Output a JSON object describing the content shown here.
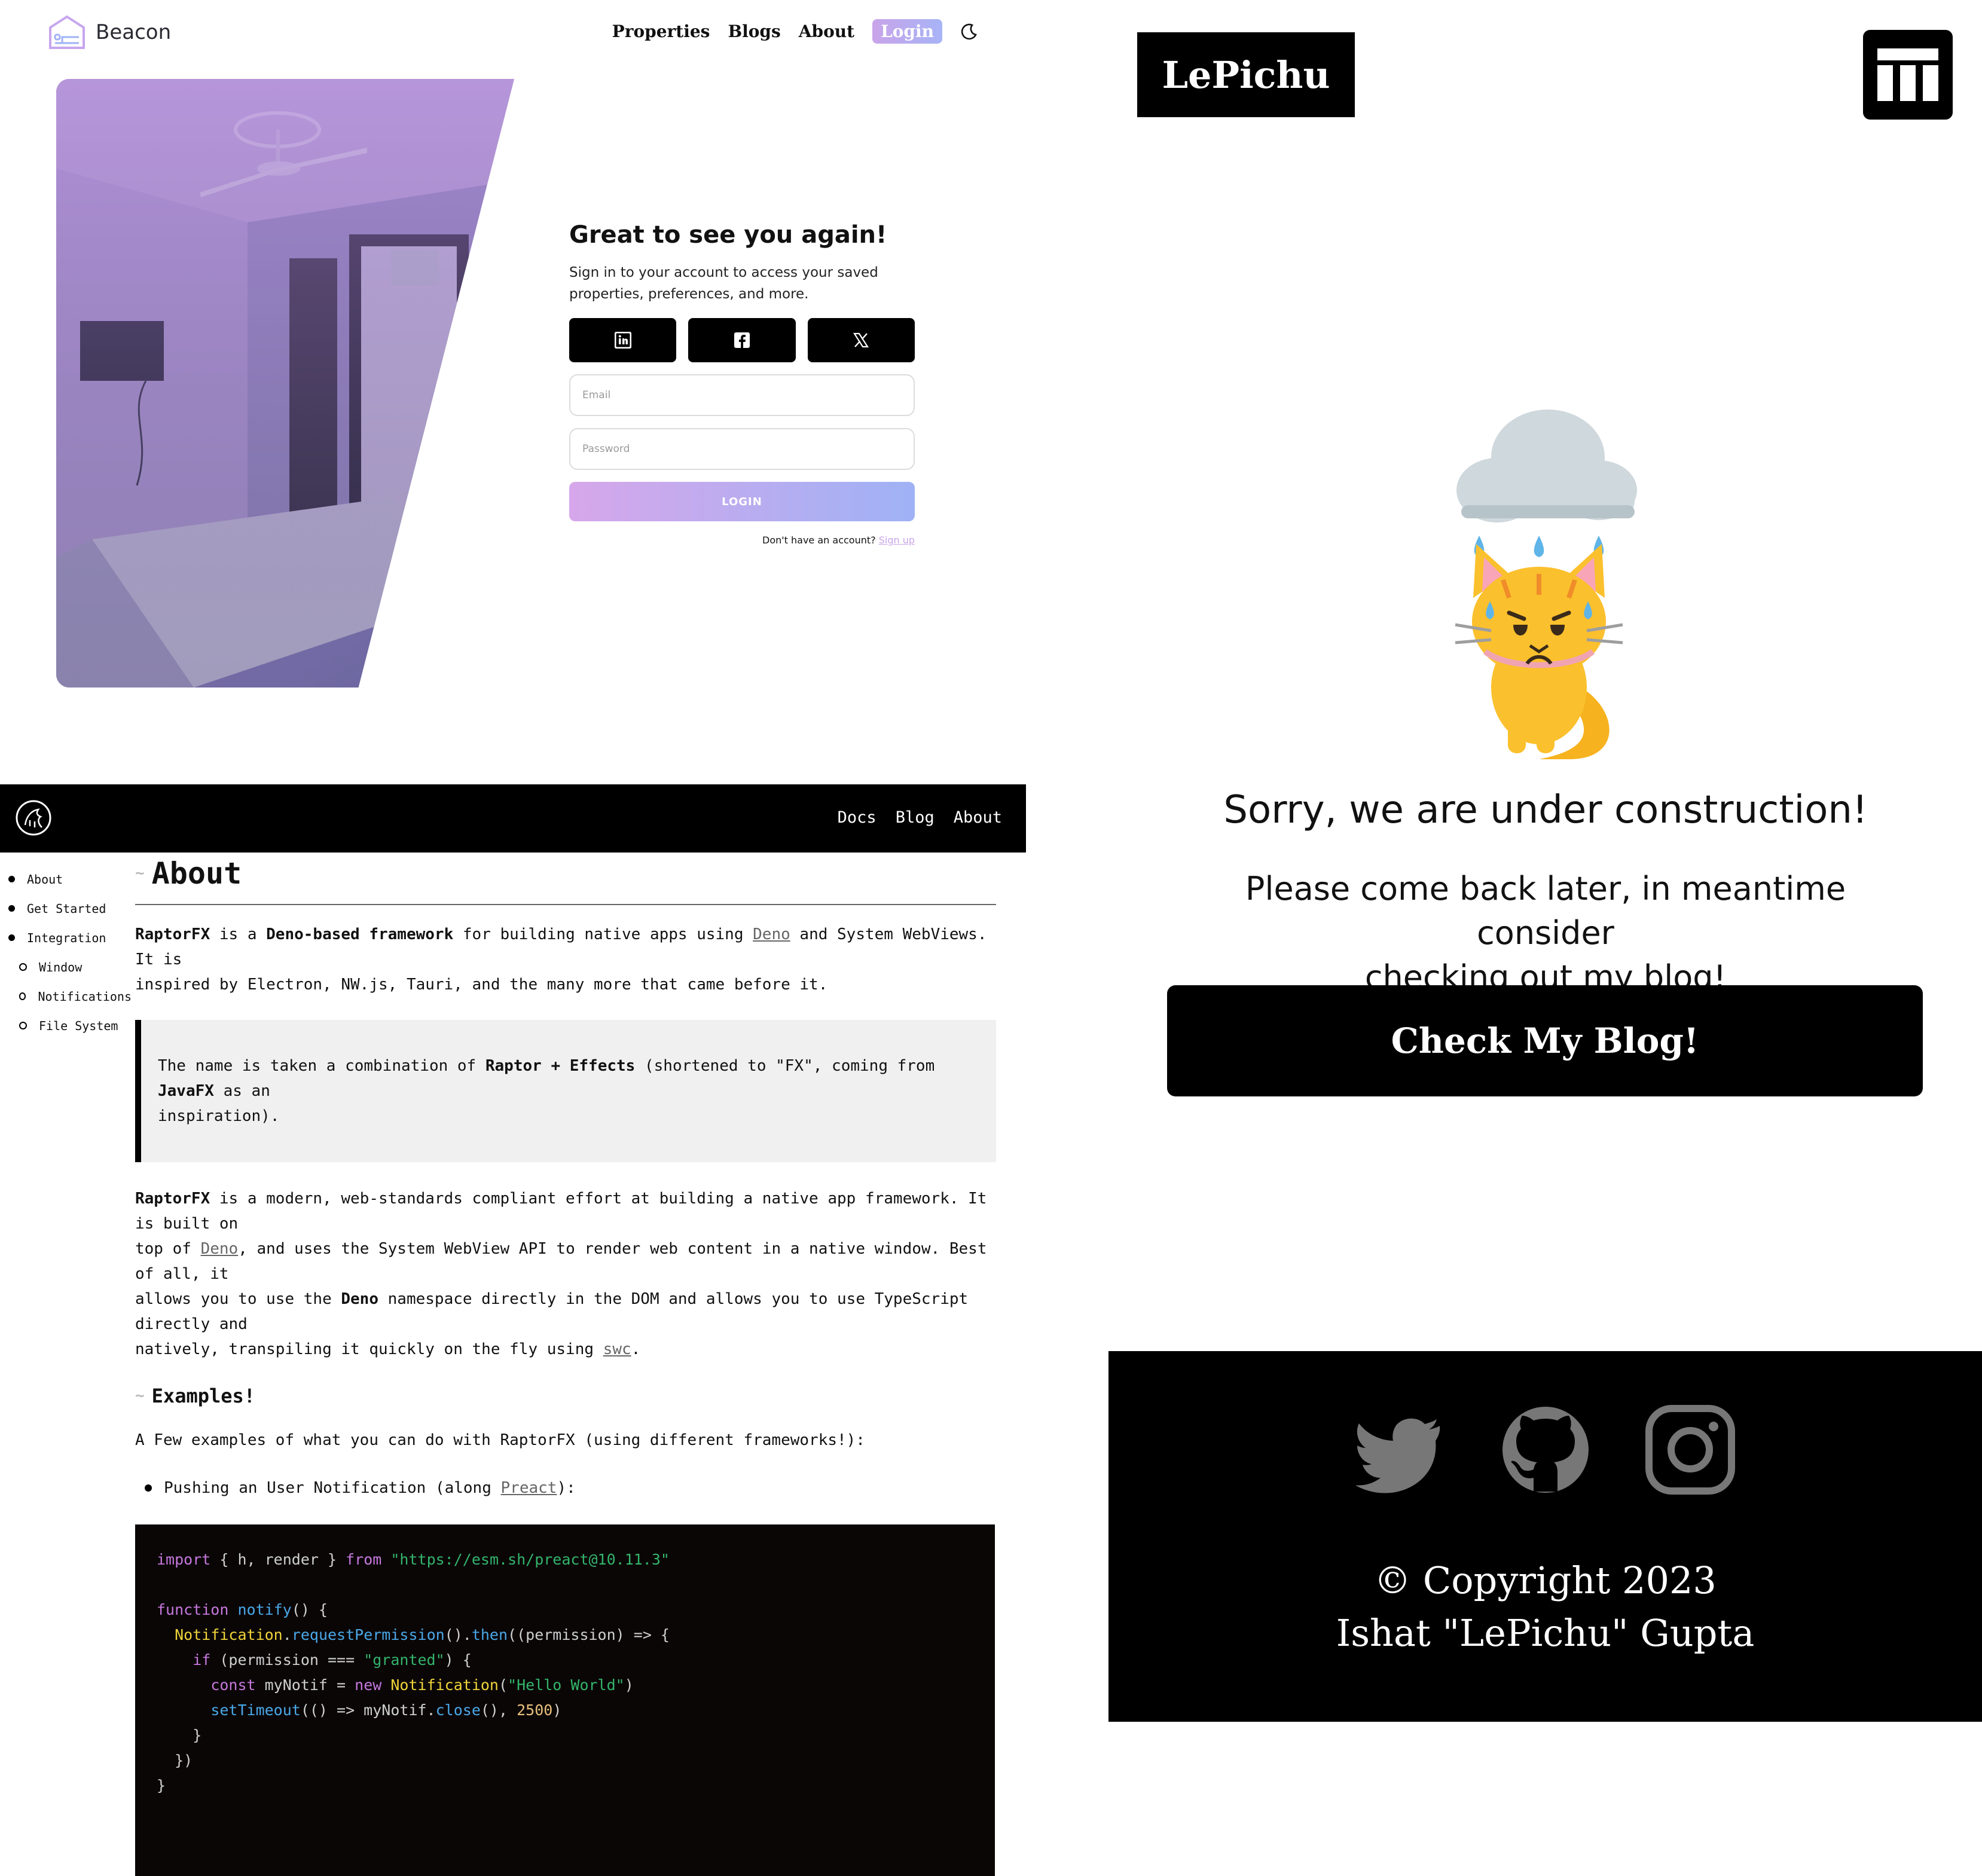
{
  "beacon": {
    "brand": "Beacon",
    "nav": [
      "Properties",
      "Blogs",
      "About"
    ],
    "login_label": "Login",
    "form": {
      "title": "Great to see you again!",
      "subtitle_line1": "Sign in to your account to access your saved",
      "subtitle_line2": "properties, preferences, and more.",
      "social_icons": [
        "linkedin-icon",
        "facebook-icon",
        "x-icon"
      ],
      "email_placeholder": "Email",
      "password_placeholder": "Password",
      "submit_label": "LOGIN",
      "signup_prompt": "Don't have an account?",
      "signup_link": "Sign up"
    },
    "accent_gradient": [
      "#c9a4ea",
      "#9fb2f5"
    ]
  },
  "lepichu": {
    "brand": "LePichu",
    "heading": "Sorry, we are under construction!",
    "subtext_line1": "Please come back later, in meantime consider",
    "subtext_line2": "checking out my blog!",
    "cta_label": "Check My Blog!",
    "social_icons": [
      "twitter-icon",
      "github-icon",
      "instagram-icon"
    ],
    "copyright_line1": "© Copyright 2023",
    "copyright_line2": "Ishat \"LePichu\" Gupta"
  },
  "raptor": {
    "nav": [
      "Docs",
      "Blog",
      "About"
    ],
    "sidebar": [
      {
        "label": "About",
        "level": 0
      },
      {
        "label": "Get Started",
        "level": 0
      },
      {
        "label": "Integration",
        "level": 0
      },
      {
        "label": "Window",
        "level": 1
      },
      {
        "label": "Notifications",
        "level": 1
      },
      {
        "label": "File System",
        "level": 1
      }
    ],
    "page_title": "About",
    "para1": {
      "a": "RaptorFX",
      "b": " is a ",
      "c": "Deno-based framework",
      "d": " for building native apps using ",
      "link": "Deno",
      "e": " and System WebViews. It is",
      "line2": "inspired by Electron, NW.js, Tauri, and the many more that came before it."
    },
    "quote": {
      "a": "The name is taken a combination of ",
      "b": "Raptor + Effects",
      "c": " (shortened to \"FX\", coming from ",
      "d": "JavaFX",
      "e": " as an",
      "line2": "inspiration)."
    },
    "para2": {
      "l1a": "RaptorFX",
      "l1b": " is a modern, web-standards compliant effort at building a native app framework. It is built on",
      "l2a": "top of ",
      "l2link": "Deno",
      "l2b": ", and uses the System WebView API to render web content in a native window. Best of all, it",
      "l3a": "allows you to use the ",
      "l3b": "Deno",
      "l3c": " namespace directly in the DOM and allows you to use TypeScript directly and",
      "l4a": "natively, transpiling it quickly on the fly using ",
      "l4link": "swc",
      "l4b": "."
    },
    "section_title": "Examples!",
    "examples_intro": "A Few examples of what you can do with RaptorFX (using different frameworks!):",
    "bullet": {
      "a": "Pushing an User Notification (along ",
      "link": "Preact",
      "b": "):"
    },
    "code": {
      "import_kw": "import",
      "import_names": " { h, render } ",
      "from_kw": "from",
      "import_url": "\"https://esm.sh/preact@10.11.3\"",
      "fn_kw": "function",
      "fn_name": "notify",
      "fn_rest": "() {",
      "l3_obj": "Notification",
      "l3_dot": ".",
      "l3_m1": "requestPermission",
      "l3_mid": "().",
      "l3_m2": "then",
      "l3_rest": "((permission) => {",
      "if_kw": "if",
      "if_cond": " (permission === ",
      "if_str": "\"granted\"",
      "if_end": ") {",
      "const_kw": "const",
      "const_var": " myNotif = ",
      "new_kw": "new",
      "new_cls": " Notification",
      "new_open": "(",
      "new_str": "\"Hello World\"",
      "new_close": ")",
      "st_fn": "setTimeout",
      "st_mid": "(() => myNotif.",
      "st_close": "close",
      "st_args": "(), ",
      "st_num": "2500",
      "st_end": ")",
      "close1": "}",
      "close2": "})",
      "close3": "}"
    }
  }
}
